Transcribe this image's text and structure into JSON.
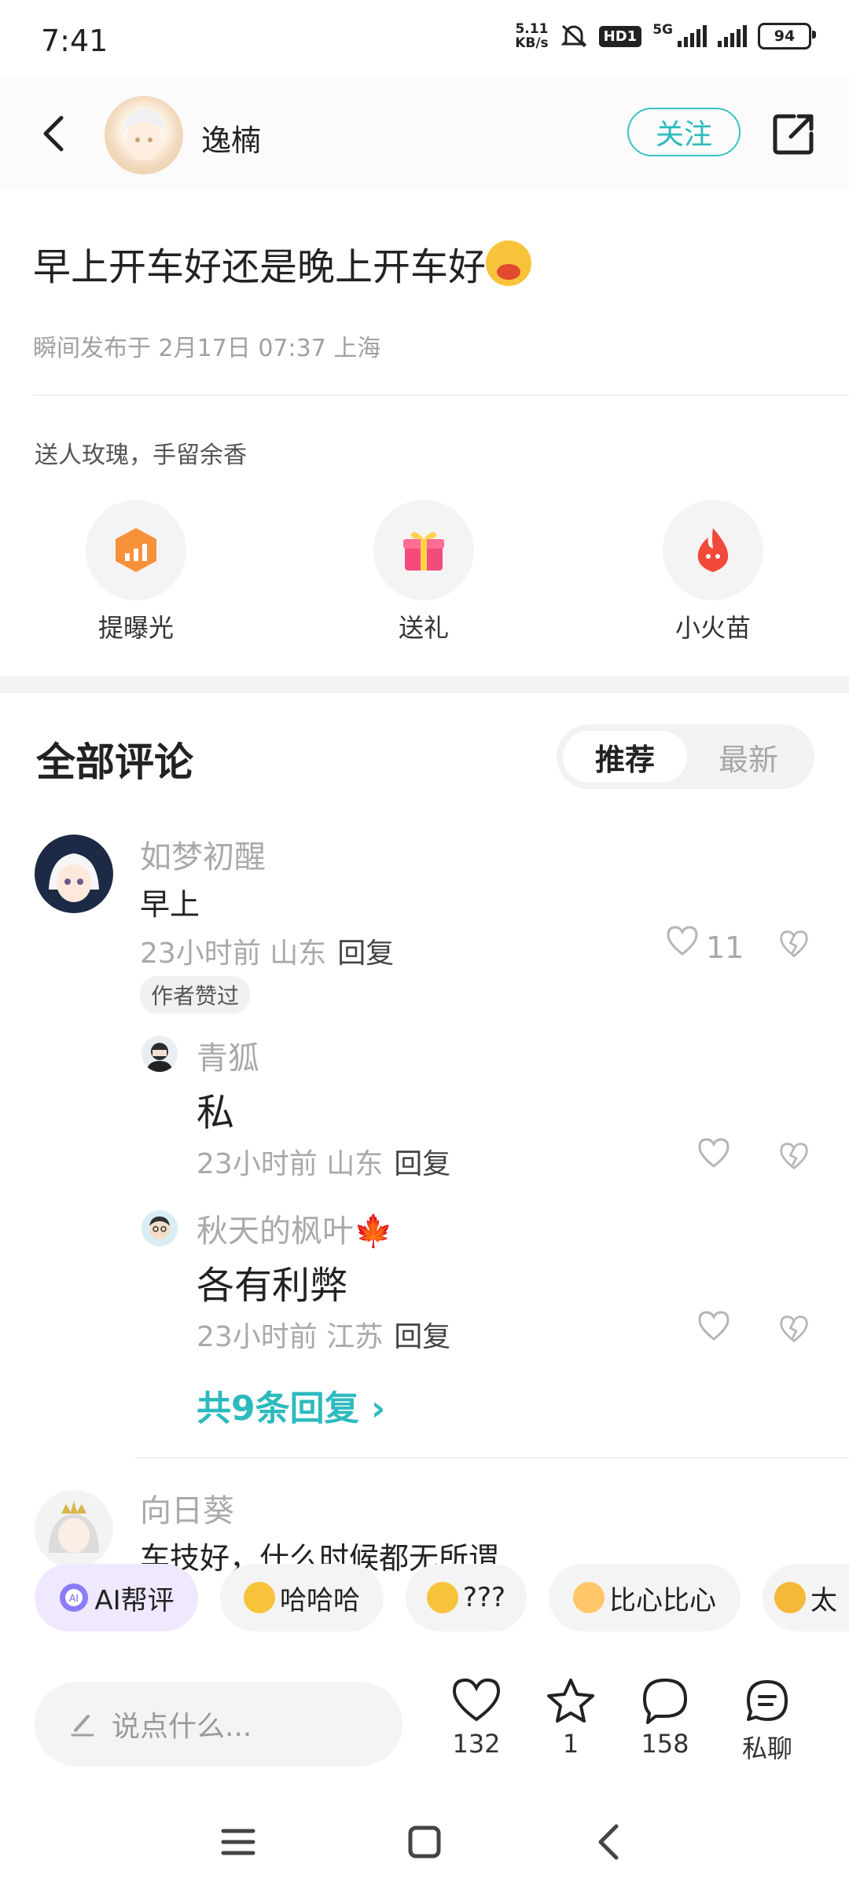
{
  "status_bar": {
    "time": "7:41",
    "net_speed": "5.11",
    "net_unit": "KB/s",
    "hd": "HD1",
    "network": "5G",
    "battery": "94"
  },
  "header": {
    "author_name": "逸楠",
    "follow_label": "关注"
  },
  "post": {
    "title": "早上开车好还是晚上开车好",
    "meta": "瞬间发布于 2月17日 07:37 上海"
  },
  "gifts": {
    "caption": "送人玫瑰，手留余香",
    "actions": [
      {
        "label": "提曝光"
      },
      {
        "label": "送礼"
      },
      {
        "label": "小火苗"
      }
    ]
  },
  "comments_section": {
    "title": "全部评论",
    "sort_tabs": [
      "推荐",
      "最新"
    ],
    "reply_label": "回复",
    "comments": [
      {
        "name": "如梦初醒",
        "text": "早上",
        "time": "23小时前",
        "location": "山东",
        "likes": "11",
        "badge": "作者赞过"
      },
      {
        "name": "向日葵",
        "text": "车技好，什么时候都无所谓"
      }
    ],
    "replies": [
      {
        "name": "青狐",
        "text": "私",
        "time": "23小时前",
        "location": "山东"
      },
      {
        "name": "秋天的枫叶🍁",
        "text": "各有利弊",
        "time": "23小时前",
        "location": "江苏"
      }
    ],
    "more_replies": "共9条回复"
  },
  "quick_chips": [
    {
      "label": "AI帮评"
    },
    {
      "label": "哈哈哈"
    },
    {
      "label": "???"
    },
    {
      "label": "比心比心"
    },
    {
      "label": "太"
    }
  ],
  "bottom_bar": {
    "input_placeholder": "说点什么...",
    "likes": "132",
    "favorites": "1",
    "comments": "158",
    "chat_label": "私聊"
  },
  "colors": {
    "accent": "#2dbabd",
    "muted": "#a9a9a9"
  }
}
